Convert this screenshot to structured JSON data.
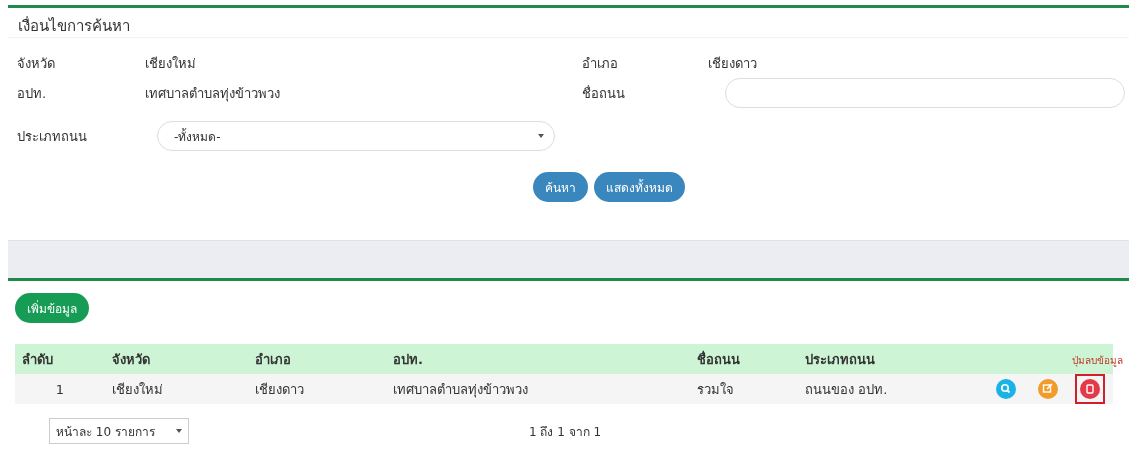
{
  "search_panel": {
    "title": "เงื่อนไขการค้นหา",
    "fields": [
      {
        "kind": "text",
        "label": "จังหวัด",
        "value": "เชียงใหม่"
      },
      {
        "kind": "text",
        "label": "อำเภอ",
        "value": "เชียงดาว"
      },
      {
        "kind": "text",
        "label": "อปท.",
        "value": "เทศบาลตำบลทุ่งข้าวพวง"
      },
      {
        "kind": "input",
        "label": "ชื่อถนน"
      },
      {
        "kind": "select",
        "label": "ประเภทถนน",
        "value": "-ทั้งหมด-"
      }
    ],
    "buttons": [
      "ค้นหา",
      "แสดงทั้งหมด"
    ]
  },
  "add_button": "เพิ่มข้อมูล",
  "annotation": "ปุ่มลบข้อมูล",
  "table": {
    "columns": [
      "ลำดับ",
      "จังหวัด",
      "อำเภอ",
      "อปท.",
      "ชื่อถนน",
      "ประเภทถนน"
    ],
    "rows": [
      {
        "cells": [
          "1",
          "เชียงใหม่",
          "เชียงดาว",
          "เทศบาลตำบลทุ่งข้าวพวง",
          "รวมใจ",
          "ถนนของ อปท."
        ],
        "actions": [
          {
            "kind": "view",
            "highlighted": false
          },
          {
            "kind": "edit",
            "highlighted": false
          },
          {
            "kind": "delete",
            "highlighted": true
          }
        ]
      }
    ]
  },
  "page_size": "หน้าละ 10 รายการ",
  "page_info": "1 ถึง 1 จาก 1"
}
